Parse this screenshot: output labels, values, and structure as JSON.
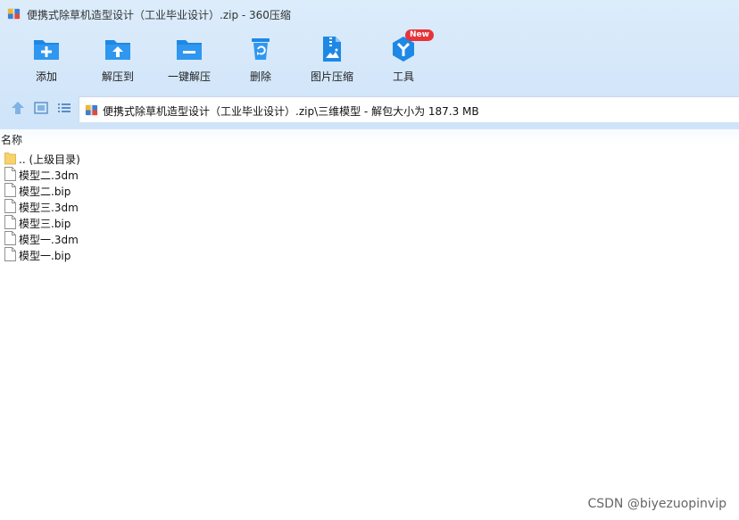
{
  "window": {
    "title": "便携式除草机造型设计（工业毕业设计）.zip - 360压缩"
  },
  "toolbar": {
    "items": [
      {
        "label": "添加",
        "icon": "add-folder-icon"
      },
      {
        "label": "解压到",
        "icon": "extract-to-icon"
      },
      {
        "label": "一键解压",
        "icon": "one-click-extract-icon"
      },
      {
        "label": "删除",
        "icon": "delete-icon"
      },
      {
        "label": "图片压缩",
        "icon": "image-compress-icon"
      },
      {
        "label": "工具",
        "icon": "tools-icon"
      }
    ],
    "new_badge": "New"
  },
  "nav": {
    "address": "便携式除草机造型设计（工业毕业设计）.zip\\三维模型 - 解包大小为 187.3 MB"
  },
  "list": {
    "column_name": "名称",
    "items": [
      {
        "name": ".. (上级目录)",
        "type": "folder"
      },
      {
        "name": "模型二.3dm",
        "type": "file"
      },
      {
        "name": "模型二.bip",
        "type": "file"
      },
      {
        "name": "模型三.3dm",
        "type": "file"
      },
      {
        "name": "模型三.bip",
        "type": "file"
      },
      {
        "name": "模型一.3dm",
        "type": "file"
      },
      {
        "name": "模型一.bip",
        "type": "file"
      }
    ]
  },
  "watermark": "CSDN @biyezuopinvip",
  "colors": {
    "accent": "#1e88e5",
    "toolbar_bg": "#d8eafb",
    "badge": "#e8333a"
  }
}
